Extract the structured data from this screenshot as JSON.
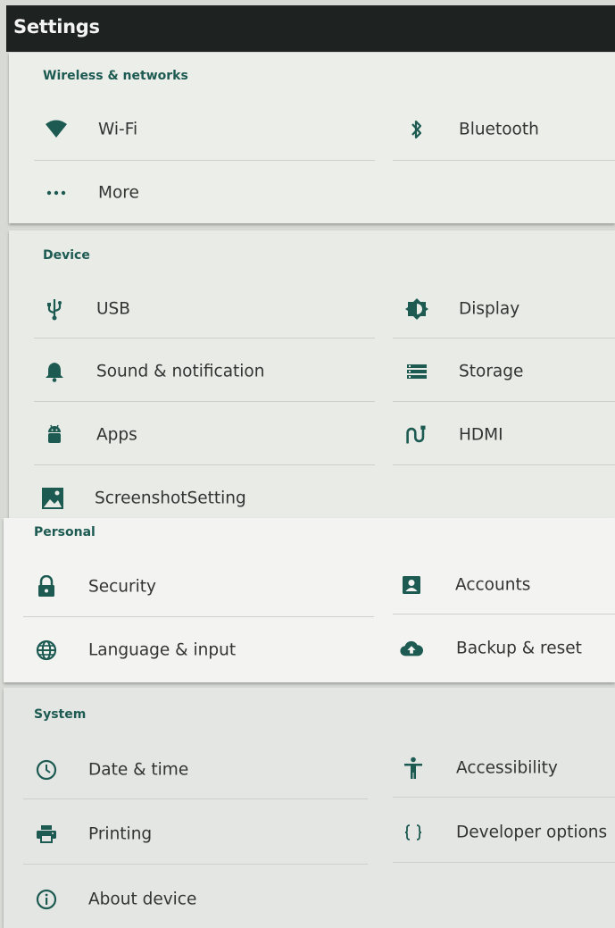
{
  "header": {
    "title": "Settings"
  },
  "sections": {
    "wireless": {
      "title": "Wireless & networks",
      "items": [
        {
          "label": "Wi-Fi",
          "icon": "wifi-icon"
        },
        {
          "label": "Bluetooth",
          "icon": "bluetooth-icon"
        },
        {
          "label": "More",
          "icon": "more-icon"
        }
      ]
    },
    "device": {
      "title": "Device",
      "items": [
        {
          "label": "USB",
          "icon": "usb-icon"
        },
        {
          "label": "Display",
          "icon": "display-icon"
        },
        {
          "label": "Sound & notification",
          "icon": "bell-icon"
        },
        {
          "label": "Storage",
          "icon": "storage-icon"
        },
        {
          "label": "Apps",
          "icon": "android-icon"
        },
        {
          "label": "HDMI",
          "icon": "hdmi-icon"
        },
        {
          "label": "ScreenshotSetting",
          "icon": "screenshot-icon"
        }
      ]
    },
    "personal": {
      "title": "Personal",
      "items": [
        {
          "label": "Security",
          "icon": "lock-icon"
        },
        {
          "label": "Accounts",
          "icon": "account-icon"
        },
        {
          "label": "Language & input",
          "icon": "globe-icon"
        },
        {
          "label": "Backup & reset",
          "icon": "cloud-upload-icon"
        }
      ]
    },
    "system": {
      "title": "System",
      "items": [
        {
          "label": "Date & time",
          "icon": "clock-icon"
        },
        {
          "label": "Accessibility",
          "icon": "accessibility-icon"
        },
        {
          "label": "Printing",
          "icon": "printer-icon"
        },
        {
          "label": "Developer options",
          "icon": "braces-icon"
        },
        {
          "label": "About device",
          "icon": "info-icon"
        }
      ]
    }
  },
  "colors": {
    "accent": "#1c5a52",
    "appbar": "#1e2220",
    "divider": "#cdd0cb"
  }
}
